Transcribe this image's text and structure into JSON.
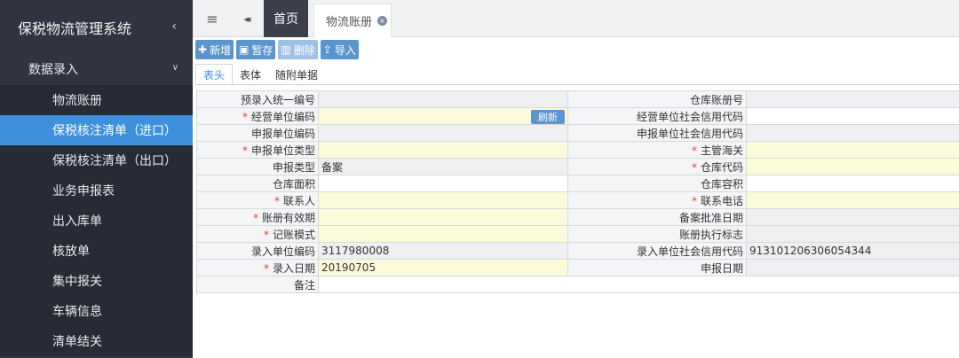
{
  "sidebar": {
    "title": "保税物流管理系统",
    "group": "数据录入",
    "items": [
      {
        "label": "物流账册"
      },
      {
        "label": "保税核注清单（进口）"
      },
      {
        "label": "保税核注清单（出口）"
      },
      {
        "label": "业务申报表"
      },
      {
        "label": "出入库单"
      },
      {
        "label": "核放单"
      },
      {
        "label": "集中报关"
      },
      {
        "label": "车辆信息"
      },
      {
        "label": "清单结关"
      }
    ],
    "active_index": 1
  },
  "topbar": {
    "menu_icon": "≡",
    "back_icon": "◂◂",
    "home_tab": "首页",
    "ledger_tab": "物流账册",
    "close_icon": "×"
  },
  "toolbar": {
    "add": "新增",
    "save": "暂存",
    "delete": "删除",
    "import": "导入"
  },
  "subtabs": [
    "表头",
    "表体",
    "随附单据"
  ],
  "form": {
    "refresh_label": "刷新",
    "rows": [
      {
        "l1": "预录入统一编号",
        "v1": "",
        "l2": "仓库账册号",
        "v2": ""
      },
      {
        "l1": "经营单位编码",
        "v1": "",
        "l2": "经营单位社会信用代码",
        "v2": ""
      },
      {
        "l1": "申报单位编码",
        "v1": "",
        "l2": "申报单位社会信用代码",
        "v2": ""
      },
      {
        "l1": "申报单位类型",
        "v1": "",
        "l2": "主管海关",
        "v2": ""
      },
      {
        "l1": "申报类型",
        "v1": "备案",
        "l2": "仓库代码",
        "v2": ""
      },
      {
        "l1": "仓库面积",
        "v1": "",
        "l2": "仓库容积",
        "v2": ""
      },
      {
        "l1": "联系人",
        "v1": "",
        "l2": "联系电话",
        "v2": ""
      },
      {
        "l1": "账册有效期",
        "v1": "",
        "l2": "备案批准日期",
        "v2": ""
      },
      {
        "l1": "记账模式",
        "v1": "",
        "l2": "账册执行标志",
        "v2": ""
      },
      {
        "l1": "录入单位编码",
        "v1": "3117980008",
        "l2": "录入单位社会信用代码",
        "v2": "913101206306054344"
      },
      {
        "l1": "录入日期",
        "v1": "20190705",
        "l2": "申报日期",
        "v2": ""
      },
      {
        "l1": "备注",
        "v1": ""
      }
    ]
  }
}
